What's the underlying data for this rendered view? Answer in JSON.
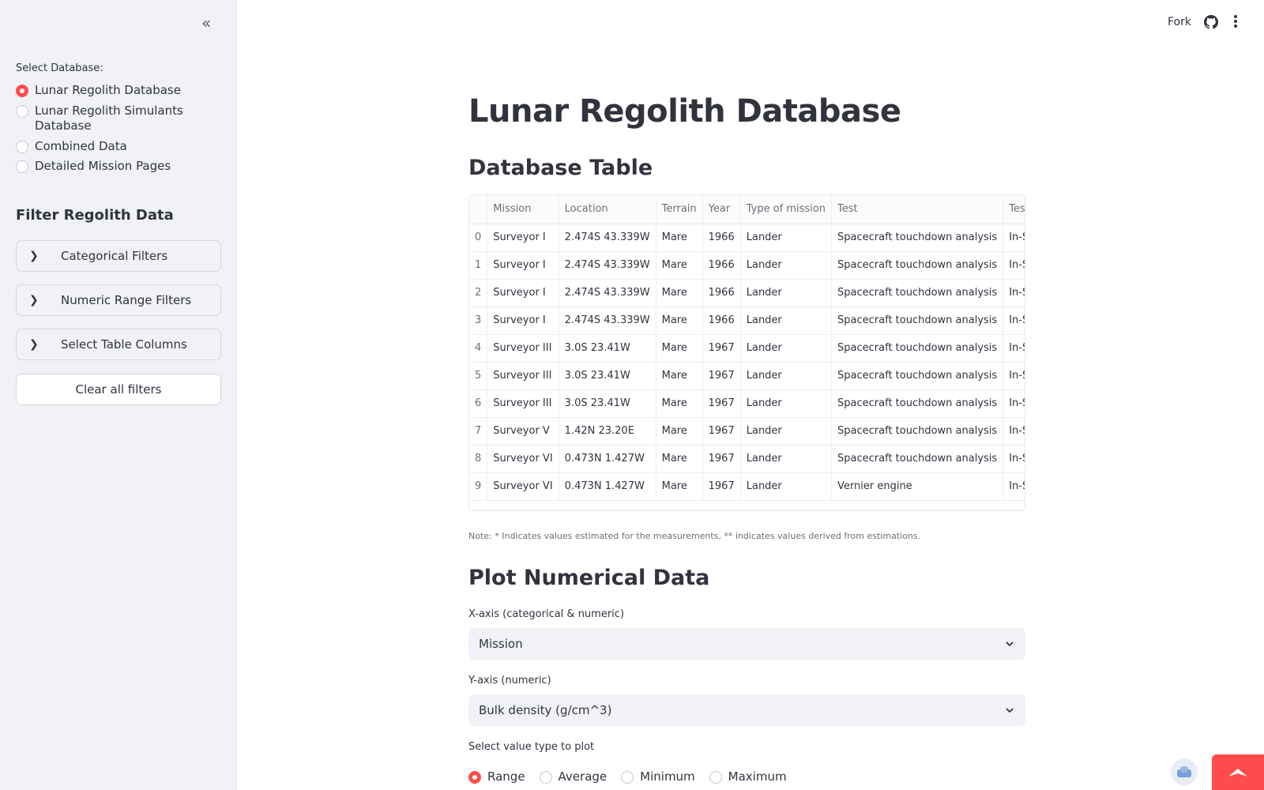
{
  "sidebar": {
    "collapse_icon": "double-chevron-left-icon",
    "select_db_label": "Select Database:",
    "db_options": [
      {
        "label": "Lunar Regolith Database",
        "selected": true
      },
      {
        "label": "Lunar Regolith Simulants Database",
        "selected": false
      },
      {
        "label": "Combined Data",
        "selected": false
      },
      {
        "label": "Detailed Mission Pages",
        "selected": false
      }
    ],
    "filter_heading": "Filter Regolith Data",
    "expanders": [
      "Categorical Filters",
      "Numeric Range Filters",
      "Select Table Columns"
    ],
    "clear_button": "Clear all filters"
  },
  "topbar": {
    "fork_label": "Fork",
    "github_icon": "github-icon",
    "menu_icon": "vertical-ellipsis-icon"
  },
  "main": {
    "title": "Lunar Regolith Database",
    "table_heading": "Database Table",
    "table": {
      "columns": [
        "",
        "Mission",
        "Location",
        "Terrain",
        "Year",
        "Type of mission",
        "Test",
        "Test"
      ],
      "rows": [
        [
          "0",
          "Surveyor I",
          "2.474S 43.339W",
          "Mare",
          "1966",
          "Lander",
          "Spacecraft touchdown analysis",
          "In-Si"
        ],
        [
          "1",
          "Surveyor I",
          "2.474S 43.339W",
          "Mare",
          "1966",
          "Lander",
          "Spacecraft touchdown analysis",
          "In-Si"
        ],
        [
          "2",
          "Surveyor I",
          "2.474S 43.339W",
          "Mare",
          "1966",
          "Lander",
          "Spacecraft touchdown analysis",
          "In-Si"
        ],
        [
          "3",
          "Surveyor I",
          "2.474S 43.339W",
          "Mare",
          "1966",
          "Lander",
          "Spacecraft touchdown analysis",
          "In-Si"
        ],
        [
          "4",
          "Surveyor III",
          "3.0S 23.41W",
          "Mare",
          "1967",
          "Lander",
          "Spacecraft touchdown analysis",
          "In-Si"
        ],
        [
          "5",
          "Surveyor III",
          "3.0S 23.41W",
          "Mare",
          "1967",
          "Lander",
          "Spacecraft touchdown analysis",
          "In-Si"
        ],
        [
          "6",
          "Surveyor III",
          "3.0S 23.41W",
          "Mare",
          "1967",
          "Lander",
          "Spacecraft touchdown analysis",
          "In-Si"
        ],
        [
          "7",
          "Surveyor V",
          "1.42N 23.20E",
          "Mare",
          "1967",
          "Lander",
          "Spacecraft touchdown analysis",
          "In-Si"
        ],
        [
          "8",
          "Surveyor VI",
          "0.473N 1.427W",
          "Mare",
          "1967",
          "Lander",
          "Spacecraft touchdown analysis",
          "In-Si"
        ],
        [
          "9",
          "Surveyor VI",
          "0.473N 1.427W",
          "Mare",
          "1967",
          "Lander",
          "Vernier engine",
          "In-Si"
        ]
      ]
    },
    "note": "Note: * Indicates values estimated for the measurements, ** indicates values derived from estimations.",
    "plot_heading": "Plot Numerical Data",
    "x_axis_label": "X-axis (categorical & numeric)",
    "x_axis_value": "Mission",
    "y_axis_label": "Y-axis (numeric)",
    "y_axis_value": "Bulk density (g/cm^3)",
    "value_type_label": "Select value type to plot",
    "value_types": [
      {
        "label": "Range",
        "selected": true
      },
      {
        "label": "Average",
        "selected": false
      },
      {
        "label": "Minimum",
        "selected": false
      },
      {
        "label": "Maximum",
        "selected": false
      }
    ]
  },
  "colors": {
    "accent": "#ff4b4b",
    "sidebar_bg": "#f0f2f6",
    "text": "#31333f"
  }
}
